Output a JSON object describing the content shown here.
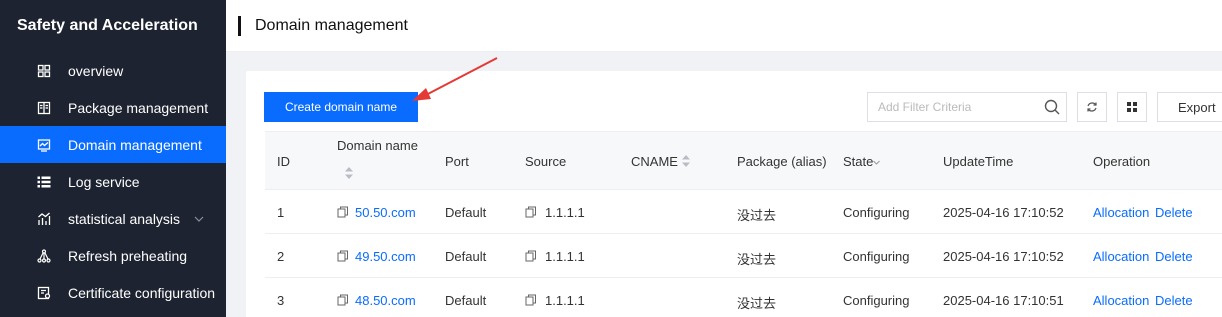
{
  "sidebar": {
    "title": "Safety and Acceleration",
    "items": [
      {
        "label": "overview",
        "icon": "grid-icon"
      },
      {
        "label": "Package management",
        "icon": "book-icon"
      },
      {
        "label": "Domain management",
        "icon": "monitor-icon",
        "active": true
      },
      {
        "label": "Log service",
        "icon": "list-icon"
      },
      {
        "label": "statistical analysis",
        "icon": "chart-icon",
        "expandable": true
      },
      {
        "label": "Refresh preheating",
        "icon": "network-icon"
      },
      {
        "label": "Certificate configuration",
        "icon": "certificate-icon"
      }
    ]
  },
  "header": {
    "title": "Domain management"
  },
  "toolbar": {
    "create_label": "Create domain name",
    "search_placeholder": "Add Filter Criteria",
    "export_label": "Export"
  },
  "table": {
    "columns": {
      "id": "ID",
      "domain": "Domain name",
      "port": "Port",
      "source": "Source",
      "cname": "CNAME",
      "package": "Package (alias)",
      "state": "State",
      "update": "UpdateTime",
      "operation": "Operation"
    },
    "rows": [
      {
        "id": "1",
        "domain": "50.50.com",
        "port": "Default",
        "source": "1.1.1.1",
        "cname": "",
        "package": "没过去",
        "state": "Configuring",
        "update": "2025-04-16 17:10:52",
        "op1": "Allocation",
        "op2": "Delete"
      },
      {
        "id": "2",
        "domain": "49.50.com",
        "port": "Default",
        "source": "1.1.1.1",
        "cname": "",
        "package": "没过去",
        "state": "Configuring",
        "update": "2025-04-16 17:10:52",
        "op1": "Allocation",
        "op2": "Delete"
      },
      {
        "id": "3",
        "domain": "48.50.com",
        "port": "Default",
        "source": "1.1.1.1",
        "cname": "",
        "package": "没过去",
        "state": "Configuring",
        "update": "2025-04-16 17:10:51",
        "op1": "Allocation",
        "op2": "Delete"
      }
    ]
  },
  "colors": {
    "accent": "#0a6cff",
    "sidebar_bg": "#1d2330",
    "annotation": "#e53935"
  }
}
